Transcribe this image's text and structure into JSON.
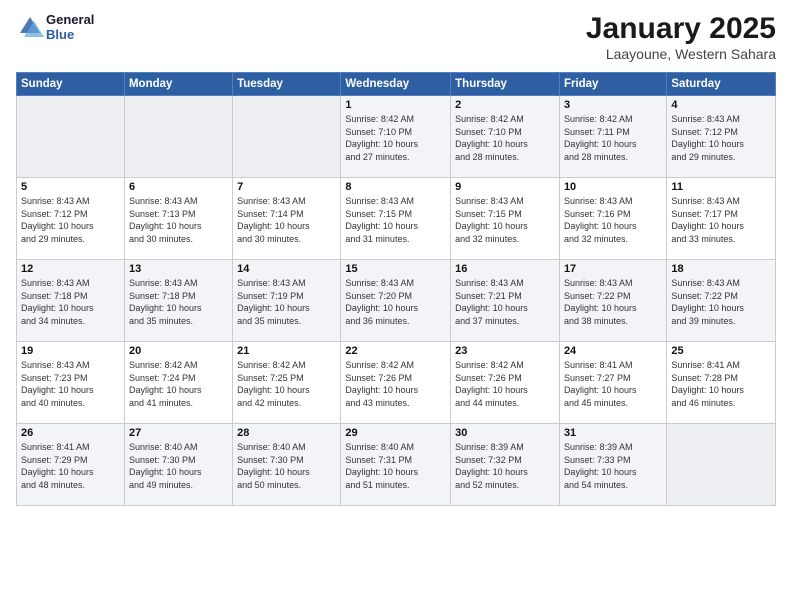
{
  "header": {
    "logo_line1": "General",
    "logo_line2": "Blue",
    "month": "January 2025",
    "location": "Laayoune, Western Sahara"
  },
  "weekdays": [
    "Sunday",
    "Monday",
    "Tuesday",
    "Wednesday",
    "Thursday",
    "Friday",
    "Saturday"
  ],
  "weeks": [
    [
      {
        "day": "",
        "info": ""
      },
      {
        "day": "",
        "info": ""
      },
      {
        "day": "",
        "info": ""
      },
      {
        "day": "1",
        "info": "Sunrise: 8:42 AM\nSunset: 7:10 PM\nDaylight: 10 hours\nand 27 minutes."
      },
      {
        "day": "2",
        "info": "Sunrise: 8:42 AM\nSunset: 7:10 PM\nDaylight: 10 hours\nand 28 minutes."
      },
      {
        "day": "3",
        "info": "Sunrise: 8:42 AM\nSunset: 7:11 PM\nDaylight: 10 hours\nand 28 minutes."
      },
      {
        "day": "4",
        "info": "Sunrise: 8:43 AM\nSunset: 7:12 PM\nDaylight: 10 hours\nand 29 minutes."
      }
    ],
    [
      {
        "day": "5",
        "info": "Sunrise: 8:43 AM\nSunset: 7:12 PM\nDaylight: 10 hours\nand 29 minutes."
      },
      {
        "day": "6",
        "info": "Sunrise: 8:43 AM\nSunset: 7:13 PM\nDaylight: 10 hours\nand 30 minutes."
      },
      {
        "day": "7",
        "info": "Sunrise: 8:43 AM\nSunset: 7:14 PM\nDaylight: 10 hours\nand 30 minutes."
      },
      {
        "day": "8",
        "info": "Sunrise: 8:43 AM\nSunset: 7:15 PM\nDaylight: 10 hours\nand 31 minutes."
      },
      {
        "day": "9",
        "info": "Sunrise: 8:43 AM\nSunset: 7:15 PM\nDaylight: 10 hours\nand 32 minutes."
      },
      {
        "day": "10",
        "info": "Sunrise: 8:43 AM\nSunset: 7:16 PM\nDaylight: 10 hours\nand 32 minutes."
      },
      {
        "day": "11",
        "info": "Sunrise: 8:43 AM\nSunset: 7:17 PM\nDaylight: 10 hours\nand 33 minutes."
      }
    ],
    [
      {
        "day": "12",
        "info": "Sunrise: 8:43 AM\nSunset: 7:18 PM\nDaylight: 10 hours\nand 34 minutes."
      },
      {
        "day": "13",
        "info": "Sunrise: 8:43 AM\nSunset: 7:18 PM\nDaylight: 10 hours\nand 35 minutes."
      },
      {
        "day": "14",
        "info": "Sunrise: 8:43 AM\nSunset: 7:19 PM\nDaylight: 10 hours\nand 35 minutes."
      },
      {
        "day": "15",
        "info": "Sunrise: 8:43 AM\nSunset: 7:20 PM\nDaylight: 10 hours\nand 36 minutes."
      },
      {
        "day": "16",
        "info": "Sunrise: 8:43 AM\nSunset: 7:21 PM\nDaylight: 10 hours\nand 37 minutes."
      },
      {
        "day": "17",
        "info": "Sunrise: 8:43 AM\nSunset: 7:22 PM\nDaylight: 10 hours\nand 38 minutes."
      },
      {
        "day": "18",
        "info": "Sunrise: 8:43 AM\nSunset: 7:22 PM\nDaylight: 10 hours\nand 39 minutes."
      }
    ],
    [
      {
        "day": "19",
        "info": "Sunrise: 8:43 AM\nSunset: 7:23 PM\nDaylight: 10 hours\nand 40 minutes."
      },
      {
        "day": "20",
        "info": "Sunrise: 8:42 AM\nSunset: 7:24 PM\nDaylight: 10 hours\nand 41 minutes."
      },
      {
        "day": "21",
        "info": "Sunrise: 8:42 AM\nSunset: 7:25 PM\nDaylight: 10 hours\nand 42 minutes."
      },
      {
        "day": "22",
        "info": "Sunrise: 8:42 AM\nSunset: 7:26 PM\nDaylight: 10 hours\nand 43 minutes."
      },
      {
        "day": "23",
        "info": "Sunrise: 8:42 AM\nSunset: 7:26 PM\nDaylight: 10 hours\nand 44 minutes."
      },
      {
        "day": "24",
        "info": "Sunrise: 8:41 AM\nSunset: 7:27 PM\nDaylight: 10 hours\nand 45 minutes."
      },
      {
        "day": "25",
        "info": "Sunrise: 8:41 AM\nSunset: 7:28 PM\nDaylight: 10 hours\nand 46 minutes."
      }
    ],
    [
      {
        "day": "26",
        "info": "Sunrise: 8:41 AM\nSunset: 7:29 PM\nDaylight: 10 hours\nand 48 minutes."
      },
      {
        "day": "27",
        "info": "Sunrise: 8:40 AM\nSunset: 7:30 PM\nDaylight: 10 hours\nand 49 minutes."
      },
      {
        "day": "28",
        "info": "Sunrise: 8:40 AM\nSunset: 7:30 PM\nDaylight: 10 hours\nand 50 minutes."
      },
      {
        "day": "29",
        "info": "Sunrise: 8:40 AM\nSunset: 7:31 PM\nDaylight: 10 hours\nand 51 minutes."
      },
      {
        "day": "30",
        "info": "Sunrise: 8:39 AM\nSunset: 7:32 PM\nDaylight: 10 hours\nand 52 minutes."
      },
      {
        "day": "31",
        "info": "Sunrise: 8:39 AM\nSunset: 7:33 PM\nDaylight: 10 hours\nand 54 minutes."
      },
      {
        "day": "",
        "info": ""
      }
    ]
  ]
}
